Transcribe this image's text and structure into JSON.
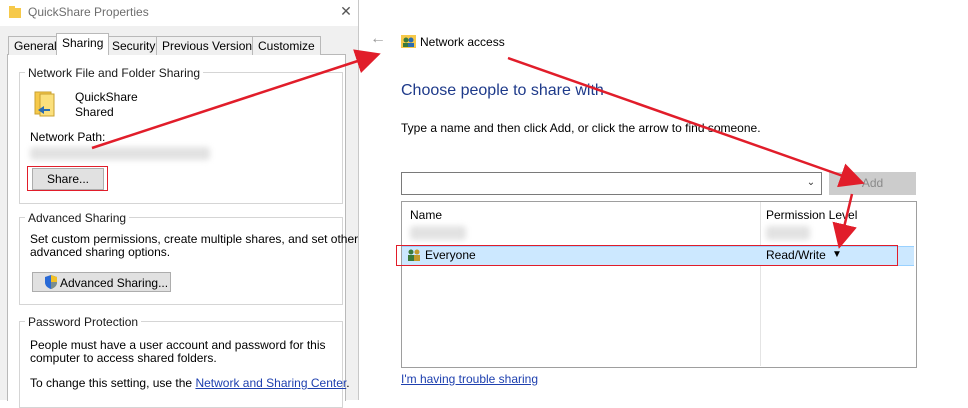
{
  "props": {
    "title": "QuickShare Properties",
    "close_glyph": "✕",
    "tabs": [
      {
        "label": "General"
      },
      {
        "label": "Sharing"
      },
      {
        "label": "Security"
      },
      {
        "label": "Previous Versions"
      },
      {
        "label": "Customize"
      }
    ],
    "net_sharing": {
      "group_label": "Network File and Folder Sharing",
      "folder_name": "QuickShare",
      "folder_status": "Shared",
      "network_path_label": "Network Path:",
      "share_button": "Share..."
    },
    "advanced": {
      "group_label": "Advanced Sharing",
      "description_line1": "Set custom permissions, create multiple shares, and set other",
      "description_line2": "advanced sharing options.",
      "button": "Advanced Sharing..."
    },
    "password": {
      "group_label": "Password Protection",
      "line1": "People must have a user account and password for this",
      "line2": "computer to access shared folders.",
      "line3_prefix": "To change this setting, use the ",
      "link": "Network and Sharing Center",
      "line3_suffix": "."
    }
  },
  "network_access": {
    "back_glyph": "←",
    "title": "Network access",
    "heading": "Choose people to share with",
    "instructions": "Type a name and then click Add, or click the arrow to find someone.",
    "name_input_value": "",
    "combo_arrow": "⌄",
    "add_button": "Add",
    "table": {
      "columns": [
        "Name",
        "Permission Level"
      ],
      "rows": [
        {
          "name": "Everyone",
          "permission": "Read/Write",
          "caret": "▼"
        }
      ]
    },
    "trouble_link": "I'm having trouble sharing"
  },
  "colors": {
    "annotation": "#e11d2a",
    "selection": "#cce8ff",
    "heading": "#1e3a8a",
    "link": "#1e40af"
  }
}
